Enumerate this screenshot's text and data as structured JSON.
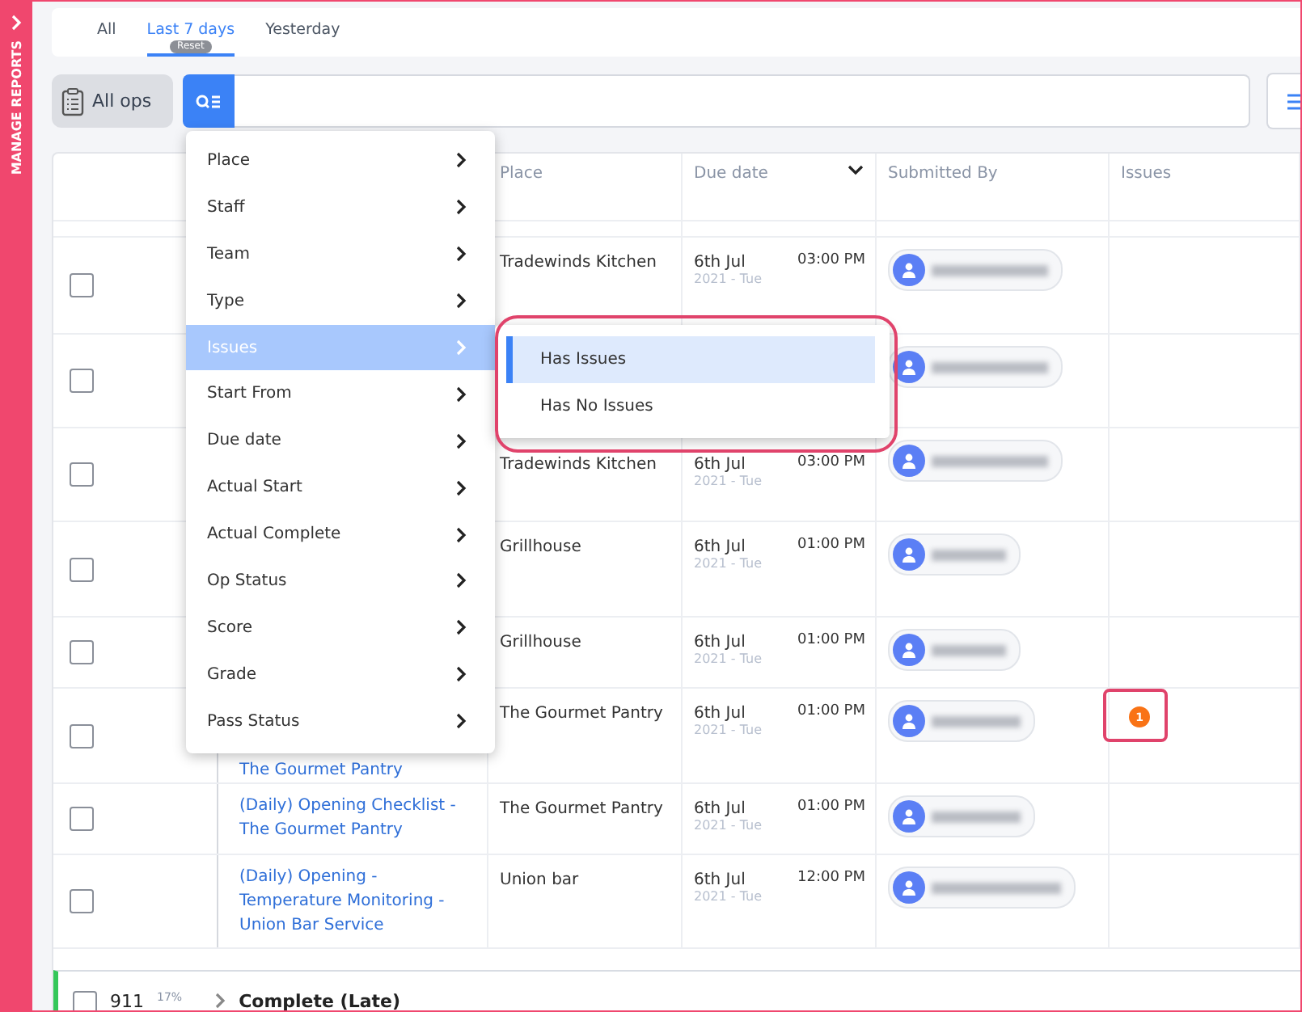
{
  "sidebar": {
    "label": "MANAGE REPORTS"
  },
  "tabs": [
    {
      "label": "All",
      "selected": false
    },
    {
      "label": "Last 7 days",
      "selected": true,
      "badge": "Reset"
    },
    {
      "label": "Yesterday",
      "selected": false
    }
  ],
  "toolbar": {
    "all_ops": "All ops"
  },
  "table": {
    "columns": [
      "Place",
      "Due date",
      "Submitted By",
      "Issues"
    ],
    "rows": [
      {
        "place": "Tradewinds Kitchen",
        "date": "6th Jul",
        "year": "2021 - Tue",
        "time": "03:00 PM",
        "checked": false
      },
      {
        "checked": false
      },
      {
        "place": "Tradewinds Kitchen",
        "date": "6th Jul",
        "year": "2021 - Tue",
        "time": "03:00 PM",
        "checked": false
      },
      {
        "place": "Grillhouse",
        "date": "6th Jul",
        "year": "2021 - Tue",
        "time": "01:00 PM",
        "checked": false
      },
      {
        "place": "Grillhouse",
        "date": "6th Jul",
        "year": "2021 - Tue",
        "time": "01:00 PM",
        "checked": false
      },
      {
        "name": "The Gourmet Pantry",
        "place": "The Gourmet Pantry",
        "date": "6th Jul",
        "year": "2021 - Tue",
        "time": "01:00 PM",
        "issues": "1",
        "checked": false
      },
      {
        "name": "(Daily) Opening Checklist - The Gourmet Pantry",
        "place": "The Gourmet Pantry",
        "date": "6th Jul",
        "year": "2021 - Tue",
        "time": "01:00 PM",
        "checked": false
      },
      {
        "name": "(Daily) Opening - Temperature Monitoring - Union Bar Service",
        "place": "Union bar",
        "date": "6th Jul",
        "year": "2021 - Tue",
        "time": "12:00 PM",
        "checked": false
      }
    ],
    "group": {
      "count": "911",
      "percent": "17%",
      "label": "Complete (Late)",
      "checked": false
    }
  },
  "filter_menu": [
    {
      "label": "Place",
      "selected": false
    },
    {
      "label": "Staff",
      "selected": false
    },
    {
      "label": "Team",
      "selected": false
    },
    {
      "label": "Type",
      "selected": false
    },
    {
      "label": "Issues",
      "selected": true
    },
    {
      "label": "Start From",
      "selected": false
    },
    {
      "label": "Due date",
      "selected": false
    },
    {
      "label": "Actual Start",
      "selected": false
    },
    {
      "label": "Actual Complete",
      "selected": false
    },
    {
      "label": "Op Status",
      "selected": false
    },
    {
      "label": "Score",
      "selected": false
    },
    {
      "label": "Grade",
      "selected": false
    },
    {
      "label": "Pass Status",
      "selected": false
    }
  ],
  "submenu": [
    {
      "label": "Has Issues",
      "selected": true
    },
    {
      "label": "Has No Issues",
      "selected": false
    }
  ]
}
